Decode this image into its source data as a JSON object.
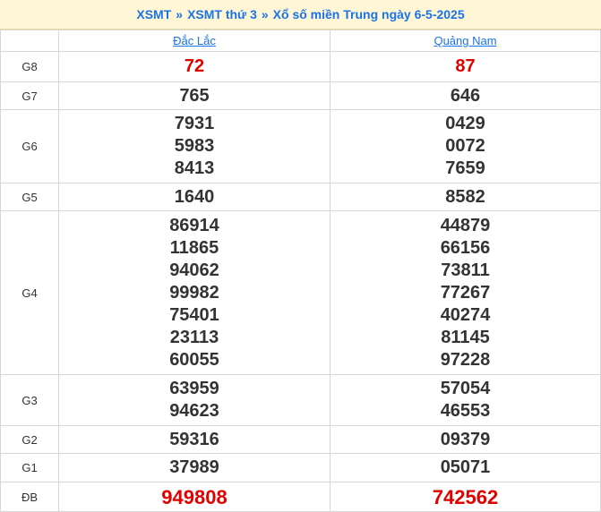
{
  "breadcrumb": {
    "link1": "XSMT",
    "link2": "XSMT thứ 3",
    "title": "Xổ số miền Trung ngày 6-5-2025",
    "separator": "»"
  },
  "provinces": [
    "Đắc Lắc",
    "Quảng Nam"
  ],
  "rows": [
    {
      "label": "G8",
      "dl": [
        "72"
      ],
      "qn": [
        "87"
      ]
    },
    {
      "label": "G7",
      "dl": [
        "765"
      ],
      "qn": [
        "646"
      ]
    },
    {
      "label": "G6",
      "dl": [
        "7931",
        "5983",
        "8413"
      ],
      "qn": [
        "0429",
        "0072",
        "7659"
      ]
    },
    {
      "label": "G5",
      "dl": [
        "1640"
      ],
      "qn": [
        "8582"
      ]
    },
    {
      "label": "G4",
      "dl": [
        "86914",
        "11865",
        "94062",
        "99982",
        "75401",
        "23113",
        "60055"
      ],
      "qn": [
        "44879",
        "66156",
        "73811",
        "77267",
        "40274",
        "81145",
        "97228"
      ]
    },
    {
      "label": "G3",
      "dl": [
        "63959",
        "94623"
      ],
      "qn": [
        "57054",
        "46553"
      ]
    },
    {
      "label": "G2",
      "dl": [
        "59316"
      ],
      "qn": [
        "09379"
      ]
    },
    {
      "label": "G1",
      "dl": [
        "37989"
      ],
      "qn": [
        "05071"
      ]
    },
    {
      "label": "ĐB",
      "dl": [
        "949808"
      ],
      "qn": [
        "742562"
      ]
    }
  ],
  "colors": {
    "accent": "#1a73e8",
    "highlight": "#e00000",
    "text": "#333333",
    "header_bg": "#fff6d6"
  }
}
